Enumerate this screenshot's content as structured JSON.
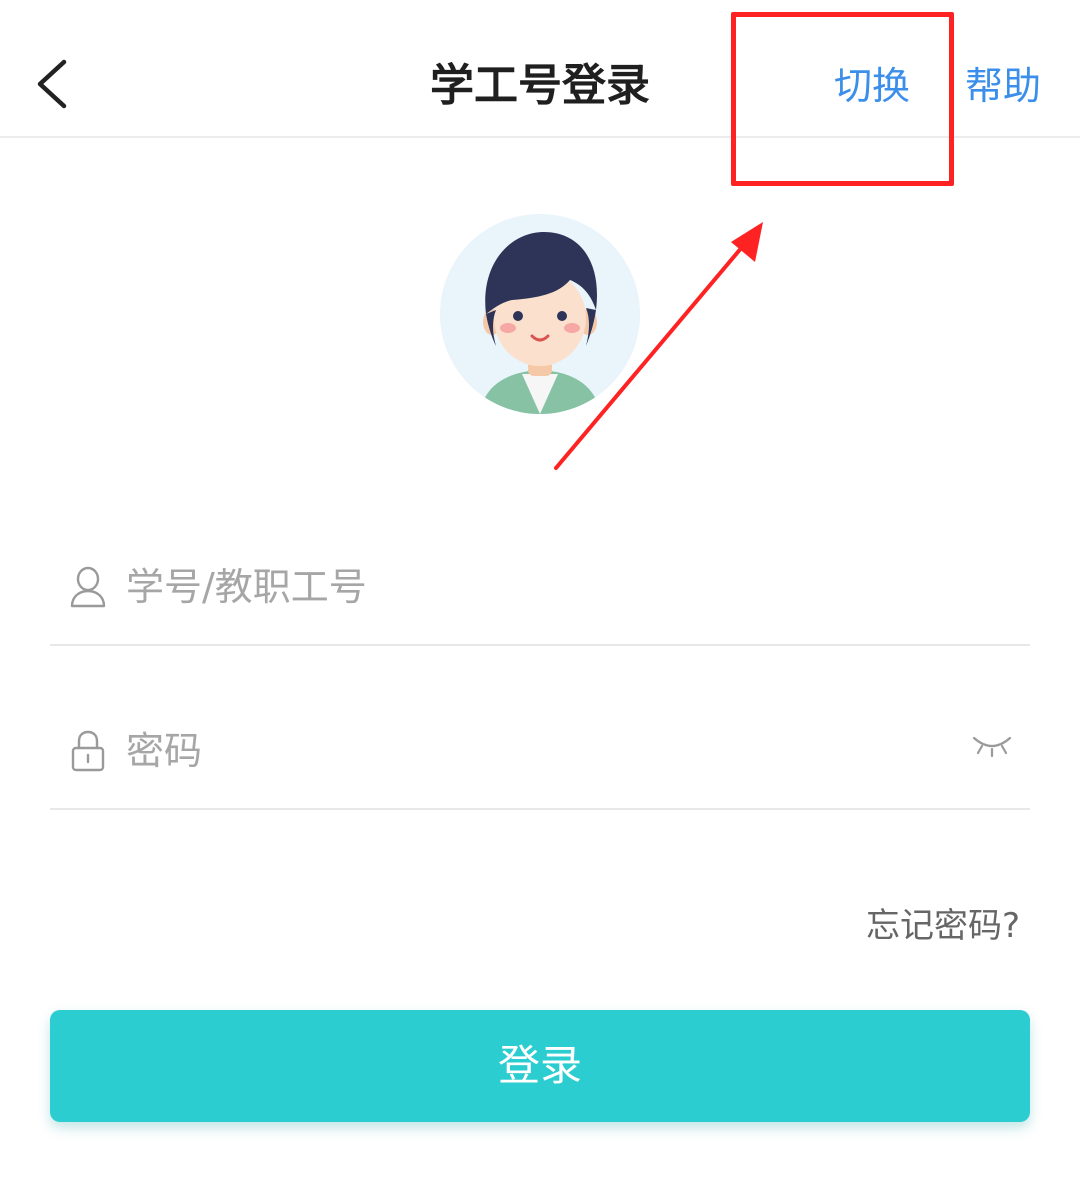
{
  "header": {
    "title": "学工号登录",
    "switch_label": "切换",
    "help_label": "帮助",
    "back_icon": "chevron-left-icon"
  },
  "avatar": {
    "icon": "user-avatar-illustration"
  },
  "form": {
    "username_placeholder": "学号/教职工号",
    "username_value": "",
    "username_icon": "user-icon",
    "password_placeholder": "密码",
    "password_value": "",
    "password_icon": "lock-icon",
    "visibility_icon": "eye-closed-icon",
    "forgot_label": "忘记密码?",
    "login_label": "登录"
  },
  "colors": {
    "accent_blue": "#3b8fea",
    "login_button": "#2bcdd0",
    "annotation_red": "#ff2222"
  }
}
